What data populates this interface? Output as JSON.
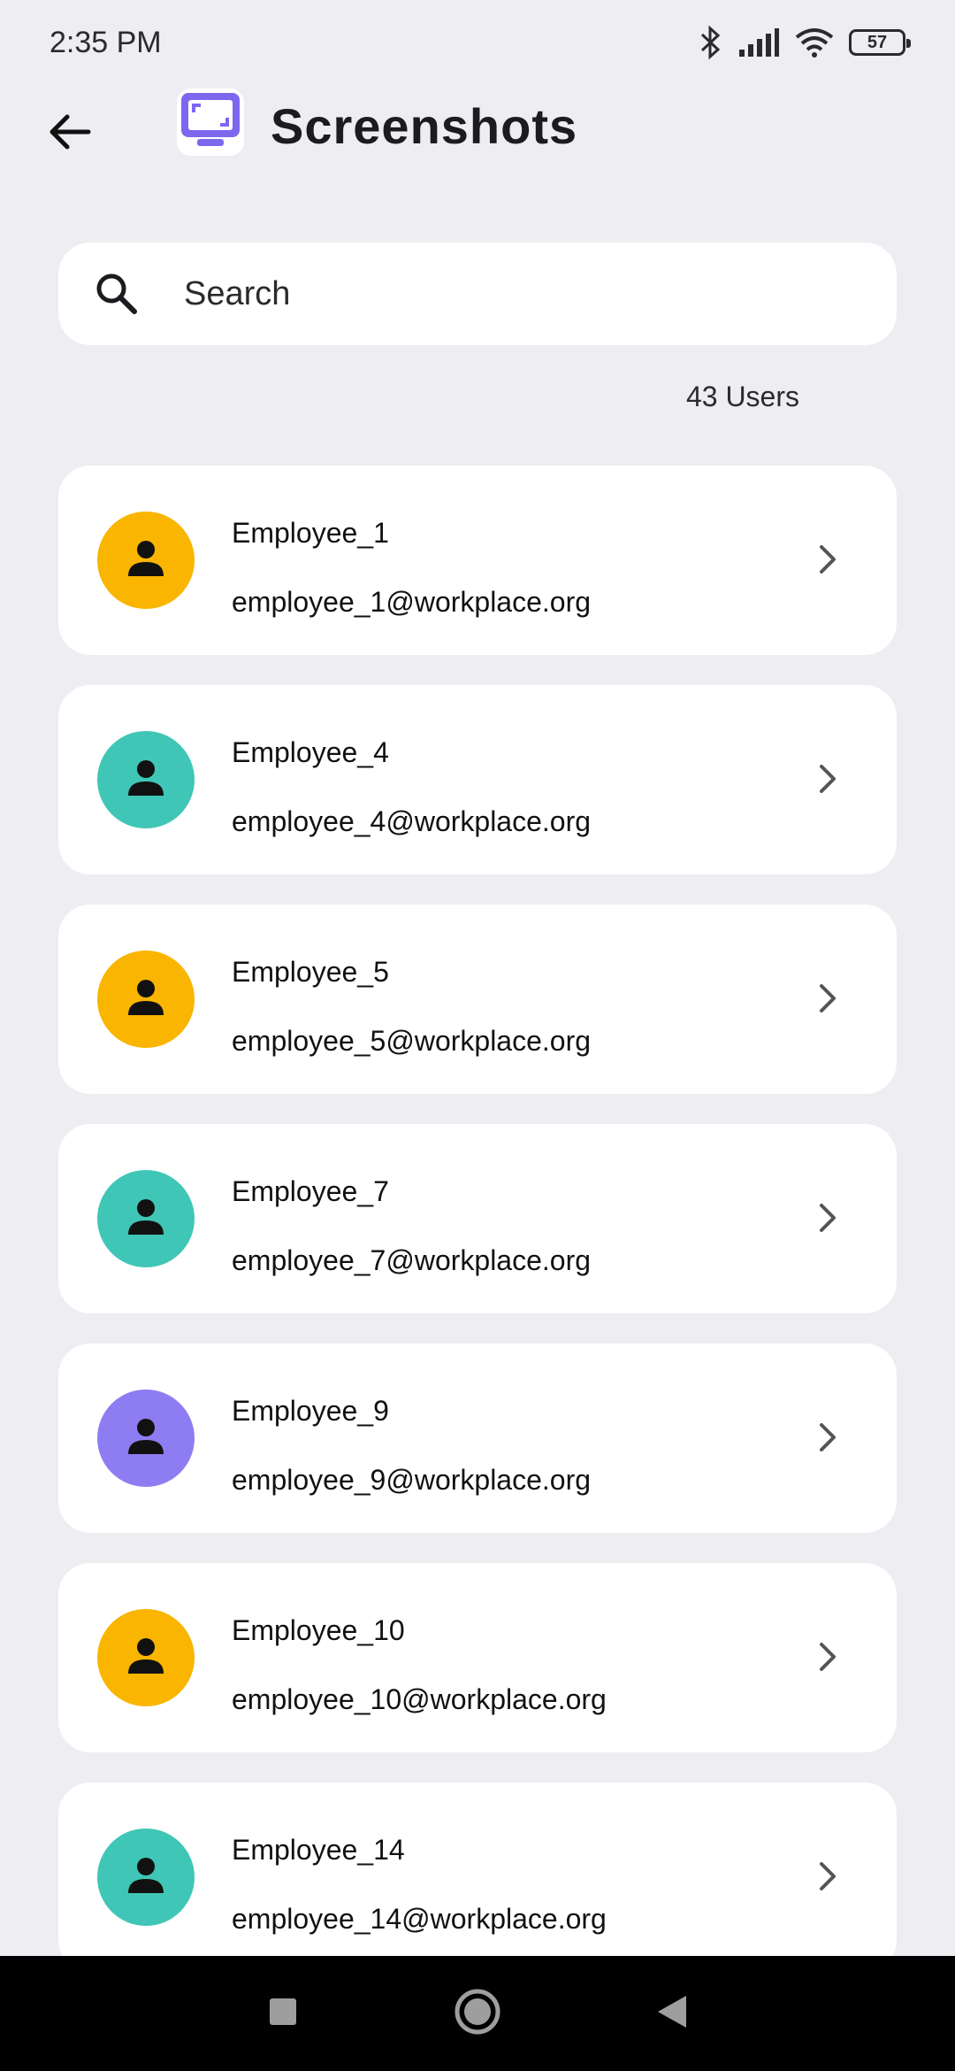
{
  "status_bar": {
    "time": "2:35 PM",
    "battery": "57"
  },
  "header": {
    "title": "Screenshots"
  },
  "search": {
    "placeholder": "Search"
  },
  "summary": {
    "user_count": "43 Users"
  },
  "colors": {
    "background": "#eeedf2",
    "logo_purple": "#7b68ee",
    "avatar_yellow": "#f9b500",
    "avatar_teal": "#3fc6b6",
    "avatar_purple": "#8e7df2"
  },
  "users": [
    {
      "name": "Employee_1",
      "email": "employee_1@workplace.org",
      "avatar_color": "#f9b500"
    },
    {
      "name": "Employee_4",
      "email": "employee_4@workplace.org",
      "avatar_color": "#3fc6b6"
    },
    {
      "name": "Employee_5",
      "email": "employee_5@workplace.org",
      "avatar_color": "#f9b500"
    },
    {
      "name": "Employee_7",
      "email": "employee_7@workplace.org",
      "avatar_color": "#3fc6b6"
    },
    {
      "name": "Employee_9",
      "email": "employee_9@workplace.org",
      "avatar_color": "#8e7df2"
    },
    {
      "name": "Employee_10",
      "email": "employee_10@workplace.org",
      "avatar_color": "#f9b500"
    },
    {
      "name": "Employee_14",
      "email": "employee_14@workplace.org",
      "avatar_color": "#3fc6b6"
    }
  ],
  "icons": {
    "back": "arrow-left-icon",
    "logo": "screenshot-monitor-icon",
    "search": "search-icon",
    "avatar": "person-icon",
    "chevron": "chevron-right-icon",
    "nav_recent": "square-icon",
    "nav_home": "circle-icon",
    "nav_back": "triangle-icon"
  }
}
